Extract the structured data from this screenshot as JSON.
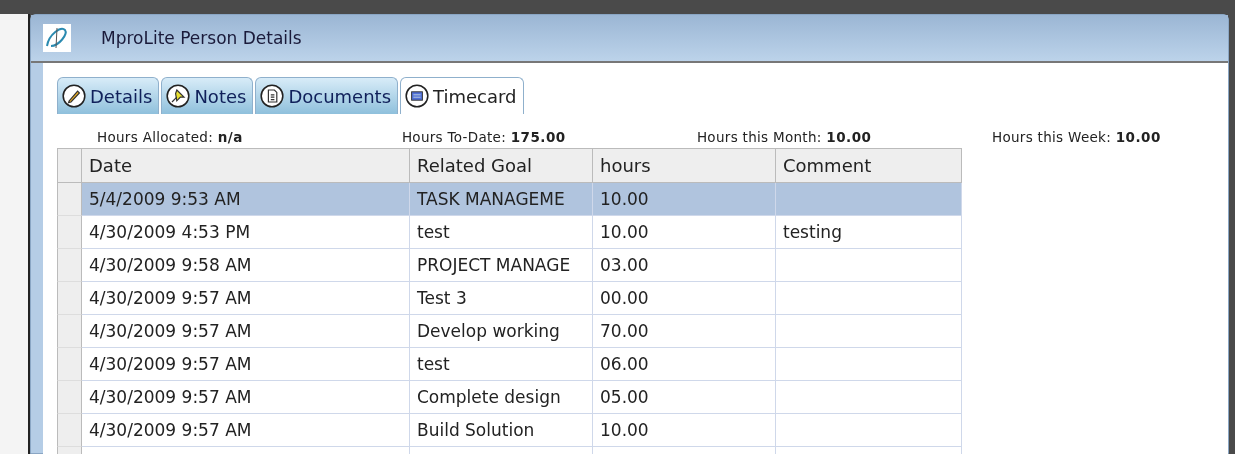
{
  "window": {
    "title": "MproLite Person Details"
  },
  "tabs": [
    {
      "label": "Details",
      "kind": "pencil",
      "selected": false
    },
    {
      "label": "Notes",
      "kind": "pin",
      "selected": false
    },
    {
      "label": "Documents",
      "kind": "document",
      "selected": false
    },
    {
      "label": "Timecard",
      "kind": "calendar",
      "selected": true
    }
  ],
  "summary": [
    {
      "label": "Hours Allocated:",
      "value": "n/a"
    },
    {
      "label": "Hours To-Date:",
      "value": "175.00"
    },
    {
      "label": "Hours this Month:",
      "value": "10.00"
    },
    {
      "label": "Hours this Week:",
      "value": "10.00"
    }
  ],
  "table": {
    "columns": [
      "Date",
      "Related Goal",
      "hours",
      "Comment"
    ],
    "rows": [
      {
        "date": "5/4/2009 9:53 AM",
        "goal": "TASK MANAGEME",
        "hours": "10.00",
        "selected": true
      },
      {
        "date": "4/30/2009 4:53 PM",
        "goal": "test",
        "hours": "10.00",
        "comment": "testing",
        "selected": false
      },
      {
        "date": "4/30/2009 9:58 AM",
        "goal": "PROJECT MANAGE",
        "hours": "03.00",
        "selected": false
      },
      {
        "date": "4/30/2009 9:57 AM",
        "goal": "Test 3",
        "hours": "00.00",
        "selected": false
      },
      {
        "date": "4/30/2009 9:57 AM",
        "goal": "Develop working",
        "hours": "70.00",
        "selected": false
      },
      {
        "date": "4/30/2009 9:57 AM",
        "goal": "test",
        "hours": "06.00",
        "selected": false
      },
      {
        "date": "4/30/2009 9:57 AM",
        "goal": "Complete design",
        "hours": "05.00",
        "selected": false
      },
      {
        "date": "4/30/2009 9:57 AM",
        "goal": "Build Solution",
        "hours": "10.00",
        "selected": false
      }
    ]
  }
}
